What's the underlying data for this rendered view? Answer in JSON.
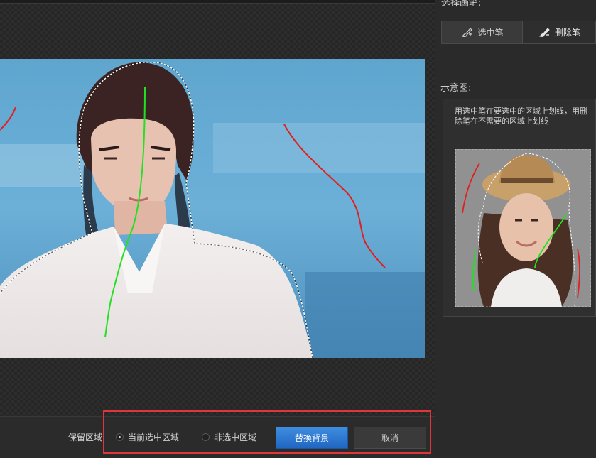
{
  "side_panel": {
    "brush_section_title": "选择画笔:",
    "brush_select_label": "选中笔",
    "brush_delete_label": "删除笔",
    "demo_title": "示意图:",
    "demo_instruction": "用选中笔在要选中的区域上划线，用删除笔在不需要的区域上划线"
  },
  "bottom_bar": {
    "keep_area_label": "保留区域:",
    "option_current_label": "当前选中区域",
    "option_current_selected": true,
    "option_non_label": "非选中区域",
    "replace_bg_label": "替换背景",
    "cancel_label": "取消"
  },
  "colors": {
    "accent_blue": "#2f7ad6",
    "select_stroke": "#22e022",
    "delete_stroke": "#e02020",
    "highlight_border": "#e0353b"
  },
  "icons": [
    "brush-select-icon",
    "brush-delete-icon",
    "radio-icon"
  ]
}
